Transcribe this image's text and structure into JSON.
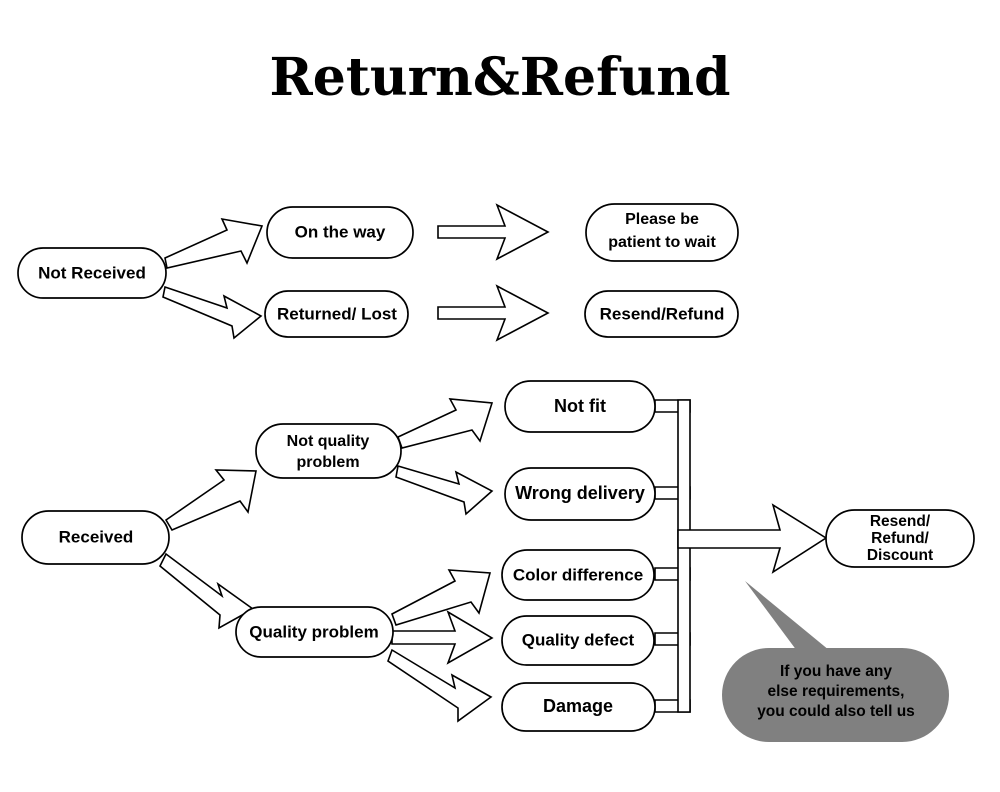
{
  "title": "Return&Refund",
  "colors": {
    "background": "#ffffff",
    "stroke": "#000000",
    "node_fill": "#ffffff",
    "bubble_fill": "#808080",
    "text": "#000000"
  },
  "nodes": {
    "not_received": "Not Received",
    "on_the_way": "On the way",
    "returned_lost": "Returned/ Lost",
    "please_wait_line1": "Please be",
    "please_wait_line2": "patient to wait",
    "resend_refund": "Resend/Refund",
    "received": "Received",
    "not_quality_line1": "Not quality",
    "not_quality_line2": "problem",
    "quality_problem": "Quality problem",
    "not_fit": "Not fit",
    "wrong_delivery": "Wrong delivery",
    "color_difference": "Color difference",
    "quality_defect": "Quality defect",
    "damage": "Damage",
    "result_line1": "Resend/",
    "result_line2": "Refund/",
    "result_line3": "Discount"
  },
  "callout": {
    "line1": "If you have any",
    "line2": "else requirements,",
    "line3": "you could also tell us"
  },
  "flows": [
    {
      "from": "Not Received",
      "to": "On the way"
    },
    {
      "from": "Not Received",
      "to": "Returned/ Lost"
    },
    {
      "from": "On the way",
      "to": "Please be patient to wait"
    },
    {
      "from": "Returned/ Lost",
      "to": "Resend/Refund"
    },
    {
      "from": "Received",
      "to": "Not quality problem"
    },
    {
      "from": "Received",
      "to": "Quality problem"
    },
    {
      "from": "Not quality problem",
      "to": "Not fit"
    },
    {
      "from": "Not quality problem",
      "to": "Wrong delivery"
    },
    {
      "from": "Quality problem",
      "to": "Color difference"
    },
    {
      "from": "Quality problem",
      "to": "Quality defect"
    },
    {
      "from": "Quality problem",
      "to": "Damage"
    },
    {
      "from": "Not fit / Wrong delivery / Color difference / Quality defect / Damage",
      "to": "Resend/ Refund/ Discount"
    }
  ]
}
